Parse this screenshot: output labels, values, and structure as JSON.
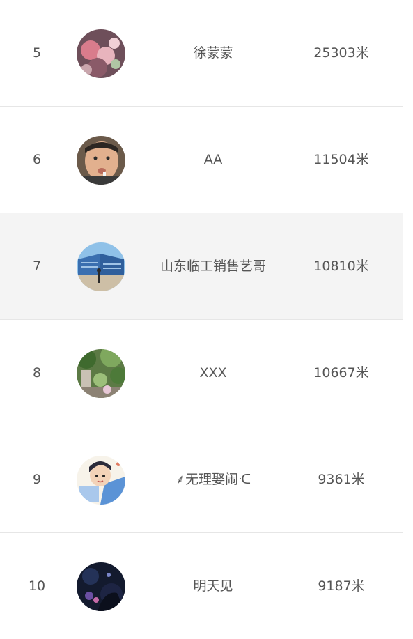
{
  "leaderboard": {
    "rows": [
      {
        "rank": "5",
        "name": "徐蒙蒙",
        "distance": "25303米",
        "avatar": "pink-flowers-avatar"
      },
      {
        "rank": "6",
        "name": "AA",
        "distance": "11504米",
        "avatar": "man-face-avatar"
      },
      {
        "rank": "7",
        "name": "山东临工销售艺哥",
        "distance": "10810米",
        "avatar": "building-avatar"
      },
      {
        "rank": "8",
        "name": "XXX",
        "distance": "10667米",
        "avatar": "garden-avatar"
      },
      {
        "rank": "9",
        "name": "⸙无理娶闹ᑡ",
        "distance": "9361米",
        "avatar": "cartoon-boy-avatar"
      },
      {
        "rank": "10",
        "name": "明天见",
        "distance": "9187米",
        "avatar": "dark-night-avatar"
      }
    ],
    "highlighted_rank": "7"
  }
}
